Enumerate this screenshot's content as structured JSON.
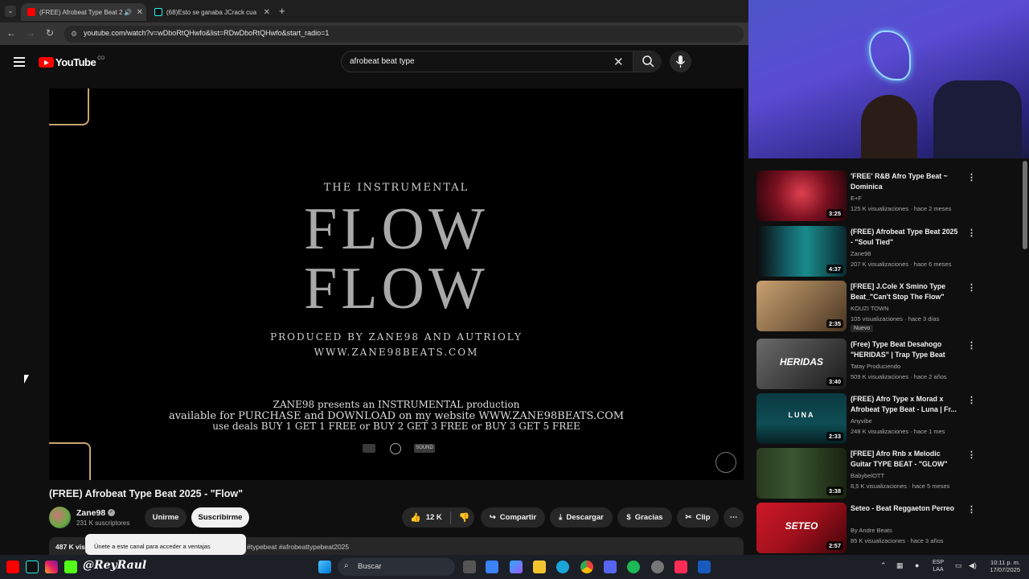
{
  "browser": {
    "tabs": [
      {
        "title": "(FREE) Afrobeat Type Beat 2",
        "active": true
      },
      {
        "title": "(68)Esto se ganaba JCrack cua",
        "active": false
      }
    ],
    "url": "youtube.com/watch?v=wDboRtQHwfo&list=RDwDboRtQHwfo&start_radio=1"
  },
  "youtube": {
    "logo_text": "YouTube",
    "logo_country": "CO",
    "search_value": "afrobeat beat type"
  },
  "video_overlay": {
    "instrumental": "THE INSTRUMENTAL",
    "flow1": "FLOW",
    "flow2": "FLOW",
    "produced": "PRODUCED BY ZANE98 AND AUTRIOLY",
    "site": "WWW.ZANE98BEATS.COM",
    "presents": "ZANE98 presents an INSTRUMENTAL production",
    "available": "available for PURCHASE and DOWNLOAD on my website WWW.ZANE98BEATS.COM",
    "deals": "use deals BUY 1 GET 1 FREE or BUY 2 GET 3 FREE or BUY 3 GET 5 FREE",
    "icon_label": "SOUND"
  },
  "video": {
    "title": "(FREE) Afrobeat Type Beat 2025 - \"Flow\"",
    "channel": "Zane98",
    "subscribers": "231 K suscriptores",
    "join_label": "Unirme",
    "subscribe_label": "Suscribirme",
    "likes": "12 K",
    "share_label": "Compartir",
    "download_label": "Descargar",
    "thanks_label": "Gracias",
    "clip_label": "Clip",
    "views_partial": "487 K vis",
    "tags_partial": "#typebeat #afrobeattypebeat2025",
    "tooltip": "Únete a este canal para acceder a ventajas"
  },
  "recommendations": [
    {
      "title": "'FREE' R&B Afro Type Beat ~ Dominica",
      "channel": "E+F",
      "meta": "125 K visualizaciones · hace 2 meses",
      "duration": "3:25",
      "thumb_color": "#7a1020",
      "label": ""
    },
    {
      "title": "(FREE) Afrobeat Type Beat 2025 - \"Soul Tied\"",
      "channel": "Zane98",
      "meta": "207 K visualizaciones · hace 6 meses",
      "duration": "4:37",
      "thumb_color": "#14606a",
      "label": ""
    },
    {
      "title": "[FREE] J.Cole X Smino Type Beat_\"Can't Stop The Flow\"",
      "channel": "KOUZI TOWN",
      "meta": "105 visualizaciones · hace 3 días",
      "duration": "2:35",
      "thumb_color": "#8a6d4a",
      "label": "",
      "badge": "Nuevo"
    },
    {
      "title": "(Free) Type Beat Desahogo \"HERIDAS\" | Trap Type Beat",
      "channel": "Tatay Produciendo",
      "meta": "509 K visualizaciones · hace 2 años",
      "duration": "3:40",
      "thumb_color": "#4a4a4a",
      "label": "HERIDAS"
    },
    {
      "title": "(FREE) Afro Type x Morad x Afrobeat Type Beat - Luna | Fr...",
      "channel": "Anyvibe",
      "meta": "248 K visualizaciones · hace 1 mes",
      "duration": "2:33",
      "thumb_color": "#0f4d55",
      "label": "LUNA"
    },
    {
      "title": "[FREE] Afro Rnb x Melodic Guitar TYPE BEAT - \"GLOW\"",
      "channel": "BabybelOTT",
      "meta": "8,5 K visualizaciones · hace 5 meses",
      "duration": "3:38",
      "thumb_color": "#3a5530",
      "label": ""
    },
    {
      "title": "Seteo - Beat Reggaeton Perreo",
      "channel": "By Andre Beats",
      "meta": "85 K visualizaciones · hace 3 años",
      "duration": "2:57",
      "thumb_color": "#a0101c",
      "label": "SETEO"
    }
  ],
  "taskbar": {
    "handle": "@ReyRaul",
    "search_label": "Buscar",
    "lang1": "ESP",
    "lang2": "LAA",
    "time": "10:11 p. m.",
    "date": "17/07/2025"
  },
  "colors": {
    "yt_red": "#ff0000",
    "background": "#0f0f0f",
    "pill": "#272727"
  }
}
